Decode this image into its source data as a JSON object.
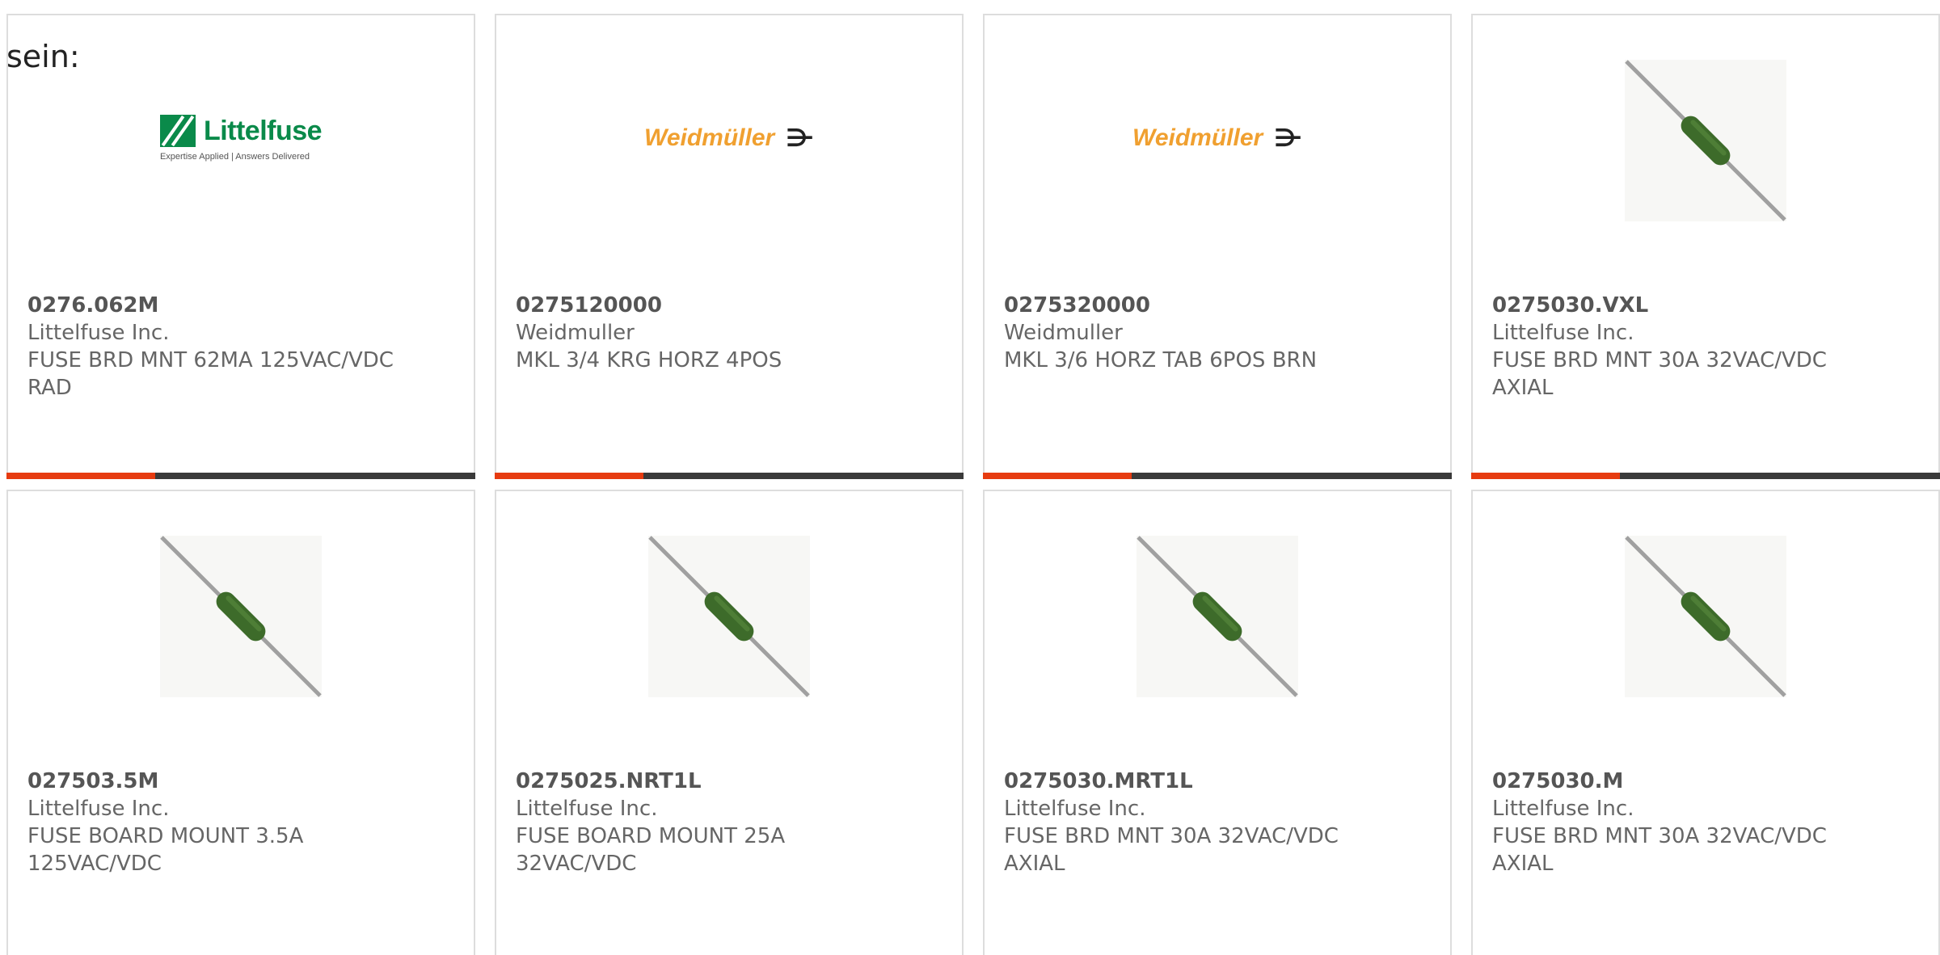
{
  "lead_text": "sein:",
  "colors": {
    "accent": "#e63b10",
    "bar": "#3a3a3a",
    "border": "#dddddd",
    "text": "#666666",
    "littelfuse_green": "#0a8a4a",
    "weidmuller_orange": "#f0a030",
    "fuse_body": "#3d6b2a"
  },
  "logos": {
    "littelfuse": {
      "name": "Littelfuse",
      "tagline": "Expertise Applied | Answers Delivered"
    },
    "weidmuller": {
      "name": "Weidmüller",
      "symbol": "⋺"
    }
  },
  "products": [
    {
      "part_number": "0276.062M",
      "manufacturer": "Littelfuse Inc.",
      "description": "FUSE BRD MNT 62MA 125VAC/VDC RAD",
      "image": "littelfuse-logo"
    },
    {
      "part_number": "0275120000",
      "manufacturer": "Weidmuller",
      "description": "MKL 3/4 KRG HORZ 4POS",
      "image": "weidmuller-logo"
    },
    {
      "part_number": "0275320000",
      "manufacturer": "Weidmuller",
      "description": "MKL 3/6 HORZ TAB 6POS BRN",
      "image": "weidmuller-logo"
    },
    {
      "part_number": "0275030.VXL",
      "manufacturer": "Littelfuse Inc.",
      "description": "FUSE BRD MNT 30A 32VAC/VDC AXIAL",
      "image": "axial-fuse"
    },
    {
      "part_number": "027503.5M",
      "manufacturer": "Littelfuse Inc.",
      "description": "FUSE BOARD MOUNT 3.5A 125VAC/VDC",
      "image": "axial-fuse"
    },
    {
      "part_number": "0275025.NRT1L",
      "manufacturer": "Littelfuse Inc.",
      "description": "FUSE BOARD MOUNT 25A 32VAC/VDC",
      "image": "axial-fuse"
    },
    {
      "part_number": "0275030.MRT1L",
      "manufacturer": "Littelfuse Inc.",
      "description": "FUSE BRD MNT 30A 32VAC/VDC AXIAL",
      "image": "axial-fuse"
    },
    {
      "part_number": "0275030.M",
      "manufacturer": "Littelfuse Inc.",
      "description": "FUSE BRD MNT 30A 32VAC/VDC AXIAL",
      "image": "axial-fuse"
    }
  ]
}
